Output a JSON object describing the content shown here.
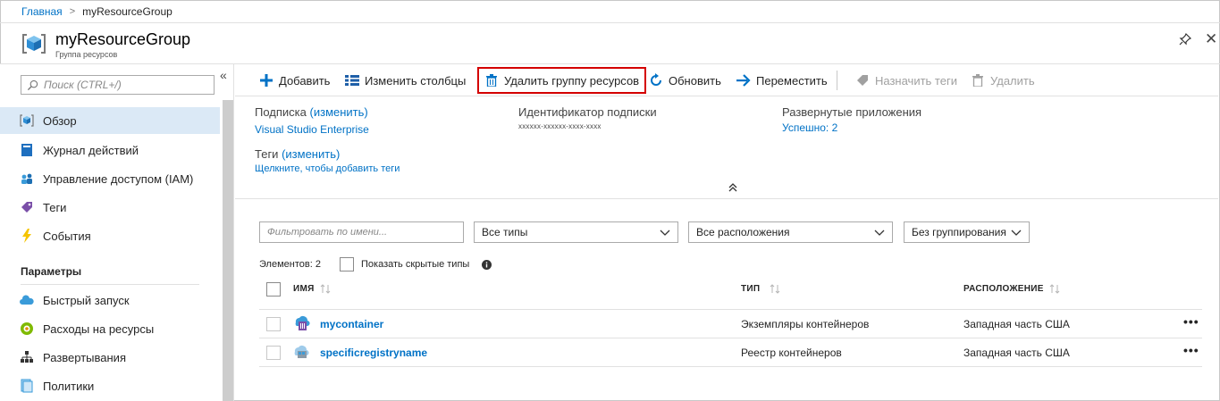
{
  "breadcrumb": {
    "home": "Главная",
    "separator": ">",
    "current": "myResourceGroup"
  },
  "header": {
    "title": "myResourceGroup",
    "subtitle": "Группа ресурсов",
    "pin_icon": "pin-icon",
    "close_icon": "close-icon"
  },
  "sidebar": {
    "search_placeholder": "Поиск (CTRL+/)",
    "collapse_glyph": "«",
    "items": [
      {
        "label": "Обзор",
        "icon": "resource-group-icon",
        "active": true
      },
      {
        "label": "Журнал действий",
        "icon": "activity-log-icon"
      },
      {
        "label": "Управление доступом (IAM)",
        "icon": "iam-icon"
      },
      {
        "label": "Теги",
        "icon": "tag-icon"
      },
      {
        "label": "События",
        "icon": "lightning-icon"
      }
    ],
    "section_label": "Параметры",
    "settings_items": [
      {
        "label": "Быстрый запуск",
        "icon": "cloud-icon"
      },
      {
        "label": "Расходы на ресурсы",
        "icon": "cost-icon"
      },
      {
        "label": "Развертывания",
        "icon": "deployments-icon"
      },
      {
        "label": "Политики",
        "icon": "policies-icon"
      }
    ]
  },
  "toolbar": {
    "add": "Добавить",
    "edit_columns": "Изменить столбцы",
    "delete_group": "Удалить группу ресурсов",
    "refresh": "Обновить",
    "move": "Переместить",
    "assign_tags": "Назначить теги",
    "delete": "Удалить"
  },
  "essentials": {
    "subscription_label": "Подписка",
    "subscription_change": "(изменить)",
    "subscription_value": "Visual Studio Enterprise",
    "subscription_id_label": "Идентификатор подписки",
    "subscription_id_value": "xxxxxx-xxxxxx-xxxx-xxxx",
    "deployments_label": "Развернутые приложения",
    "deployments_value": "Успешно: 2",
    "tags_label": "Теги",
    "tags_change": "(изменить)",
    "tags_add": "Щелкните, чтобы добавить теги"
  },
  "filters": {
    "name_placeholder": "Фильтровать по имени...",
    "types": "Все типы",
    "locations": "Все расположения",
    "grouping": "Без группирования"
  },
  "list": {
    "count": "Элементов: 2",
    "show_hidden": "Показать скрытые типы",
    "columns": {
      "name": "ИМЯ",
      "type": "ТИП",
      "location": "РАСПОЛОЖЕНИЕ"
    },
    "rows": [
      {
        "name": "mycontainer",
        "type": "Экземпляры контейнеров",
        "location": "Западная часть США",
        "icon": "container-instances-icon"
      },
      {
        "name": "specificregistryname",
        "type": "Реестр контейнеров",
        "location": "Западная часть США",
        "icon": "container-registry-icon"
      }
    ],
    "more_glyph": "•••"
  },
  "colors": {
    "accent": "#0072c6",
    "highlight_border": "#d40000",
    "active_nav": "#dbe9f6"
  }
}
